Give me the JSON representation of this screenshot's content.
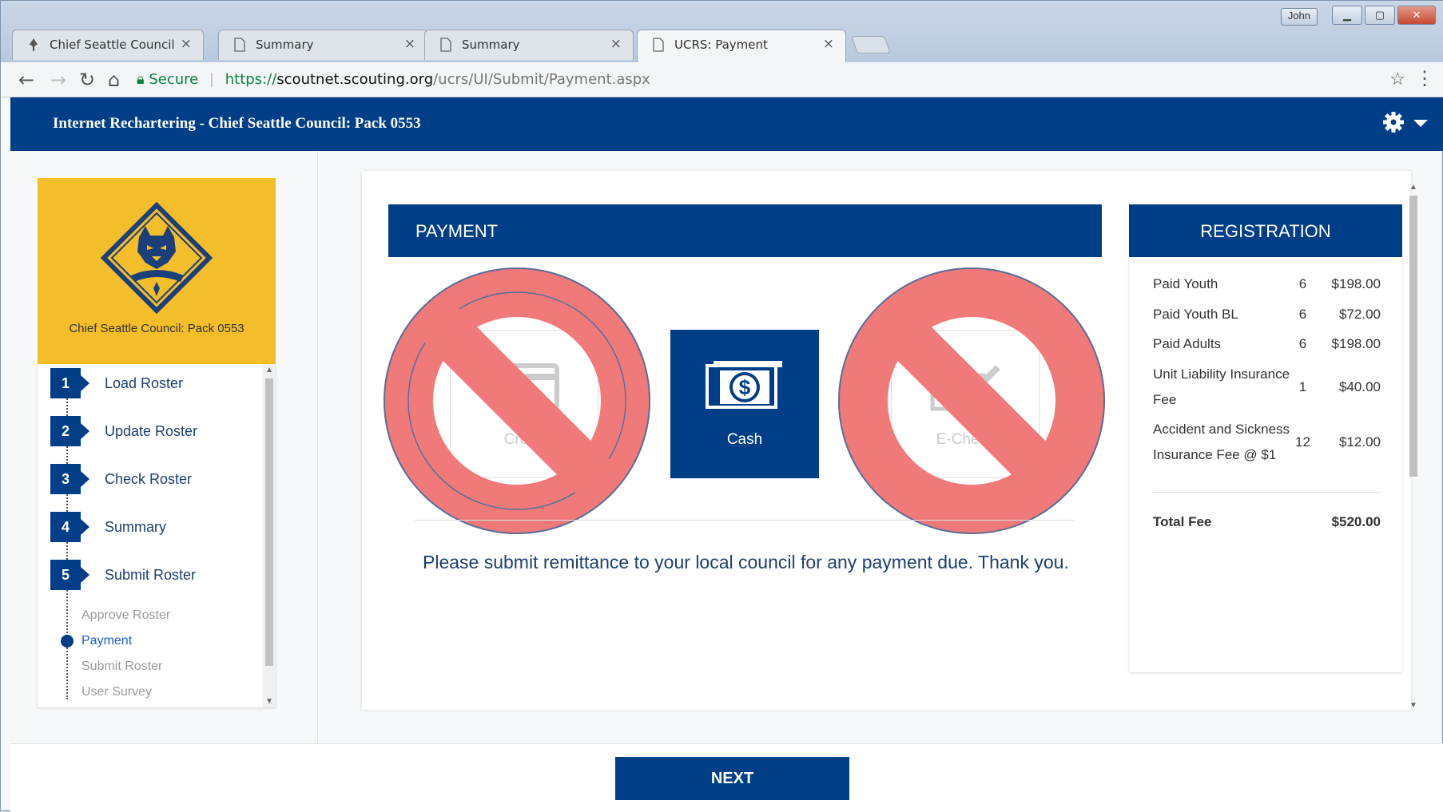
{
  "browser": {
    "tabs": [
      {
        "label": "Chief Seattle Council",
        "icon": "fleur-de-lis-icon"
      },
      {
        "label": "Summary",
        "icon": "document-icon"
      },
      {
        "label": "Summary",
        "icon": "document-icon"
      },
      {
        "label": "UCRS: Payment",
        "icon": "document-icon"
      }
    ],
    "user": "John",
    "address": {
      "secure_label": "Secure",
      "scheme": "https://",
      "host": "scoutnet.scouting.org",
      "path": "/ucrs/UI/Submit/Payment.aspx"
    }
  },
  "header": {
    "title": "Internet Rechartering - Chief Seattle Council: Pack 0553"
  },
  "sidebar": {
    "unit_name": "Chief Seattle Council: Pack 0553",
    "steps": [
      {
        "num": "1",
        "label": "Load Roster"
      },
      {
        "num": "2",
        "label": "Update Roster"
      },
      {
        "num": "3",
        "label": "Check Roster"
      },
      {
        "num": "4",
        "label": "Summary"
      },
      {
        "num": "5",
        "label": "Submit Roster"
      }
    ],
    "substeps": [
      "Approve Roster",
      "Payment",
      "Submit Roster",
      "User Survey"
    ],
    "current_substep": "Payment"
  },
  "payment": {
    "heading": "PAYMENT",
    "options": [
      {
        "label": "Credit",
        "state": "disabled"
      },
      {
        "label": "Cash",
        "state": "selected"
      },
      {
        "label": "E-Check",
        "state": "disabled"
      }
    ],
    "notice": "Please submit remittance to your local council for any payment due. Thank you."
  },
  "registration": {
    "heading": "REGISTRATION",
    "rows": [
      {
        "label": "Paid Youth",
        "qty": "6",
        "amount": "$198.00"
      },
      {
        "label": "Paid Youth BL",
        "qty": "6",
        "amount": "$72.00"
      },
      {
        "label": "Paid Adults",
        "qty": "6",
        "amount": "$198.00"
      },
      {
        "label": "Unit Liability Insurance Fee",
        "qty": "1",
        "amount": "$40.00"
      },
      {
        "label": "Accident and Sickness Insurance Fee @ $1",
        "qty": "12",
        "amount": "$12.00"
      }
    ],
    "total_label": "Total Fee",
    "total_amount": "$520.00"
  },
  "footer": {
    "next_label": "NEXT"
  },
  "colors": {
    "brand_blue": "#003f87",
    "gold": "#f4bd2a",
    "prohibited_red": "#f07a7a"
  }
}
